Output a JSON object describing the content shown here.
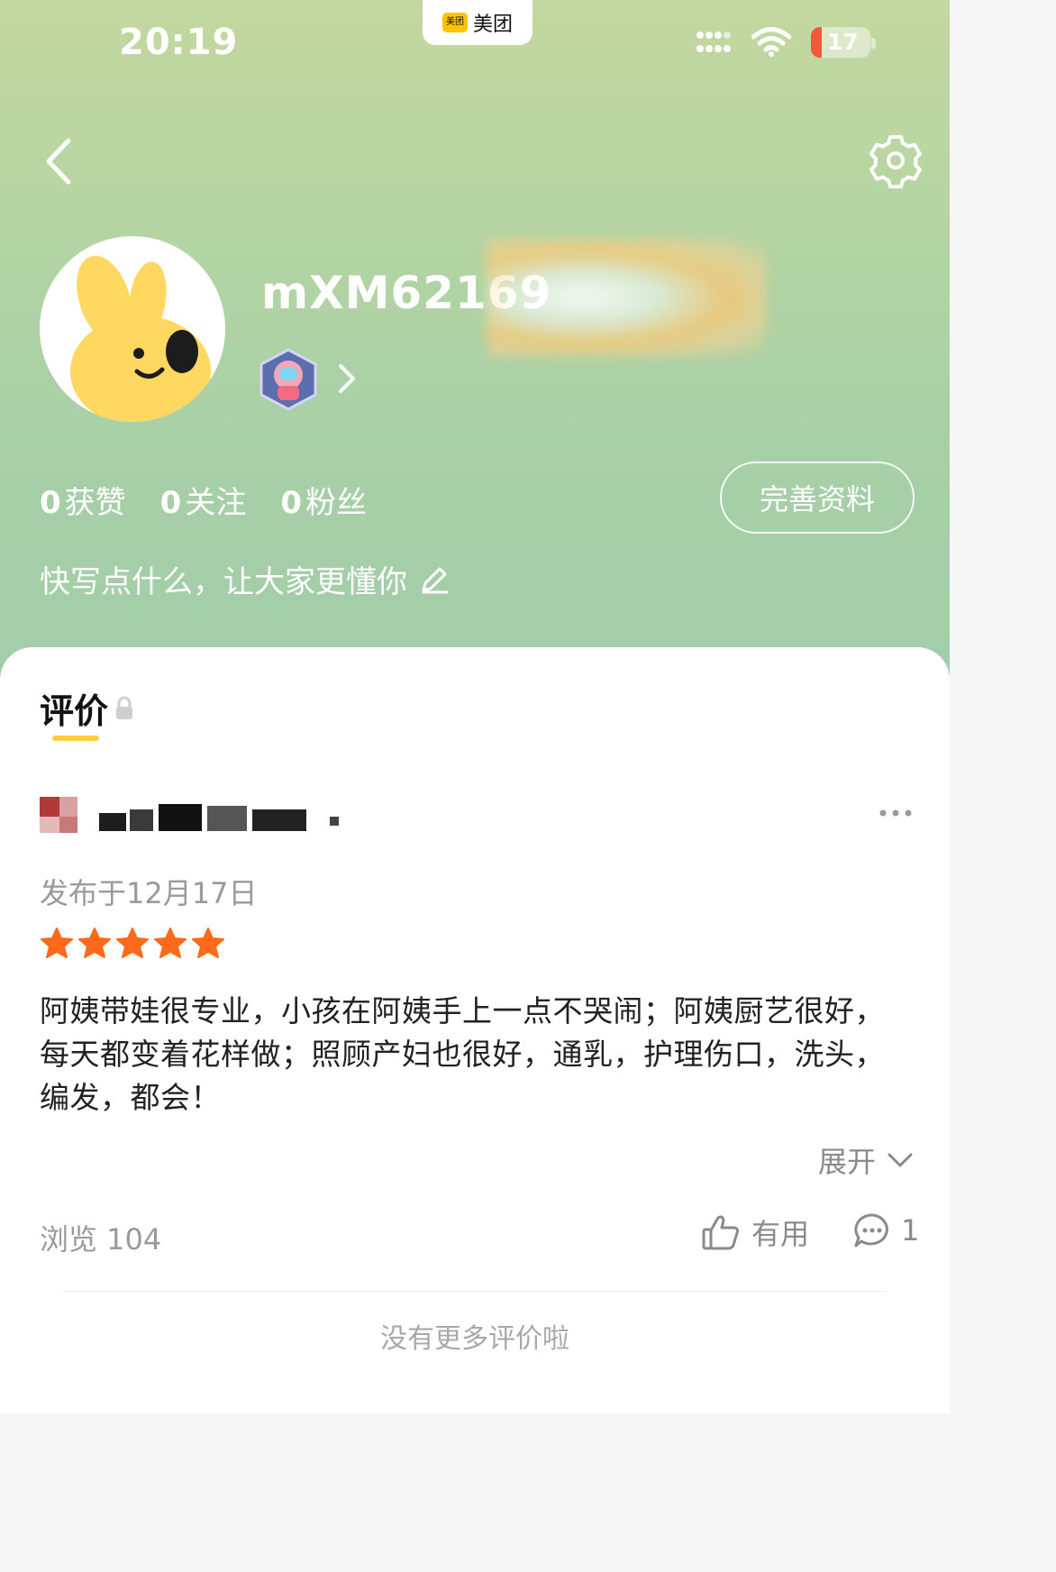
{
  "status_bar": {
    "time": "20:19",
    "app_name": "美团",
    "app_logo_text": "美团",
    "battery": "17"
  },
  "profile": {
    "username": "mXM62169",
    "stats": [
      {
        "num": "0",
        "label": "获赞"
      },
      {
        "num": "0",
        "label": "关注"
      },
      {
        "num": "0",
        "label": "粉丝"
      }
    ],
    "edit_button_label": "完善资料",
    "bio_placeholder": "快写点什么，让大家更懂你"
  },
  "tab": {
    "label": "评价"
  },
  "review": {
    "date": "发布于12月17日",
    "rating": 5,
    "text": "阿姨带娃很专业，小孩在阿姨手上一点不哭闹；阿姨厨艺很好，每天都变着花样做；照顾产妇也很好，通乳，护理伤口，洗头，编发，都会！",
    "expand_label": "展开",
    "views_label": "浏览 104",
    "useful_label": "有用",
    "comment_count": "1"
  },
  "footer": {
    "no_more": "没有更多评价啦"
  },
  "colors": {
    "star": "#ff6a1a",
    "tab_underline": "#ffcf40",
    "battery_low": "#f0593a"
  }
}
